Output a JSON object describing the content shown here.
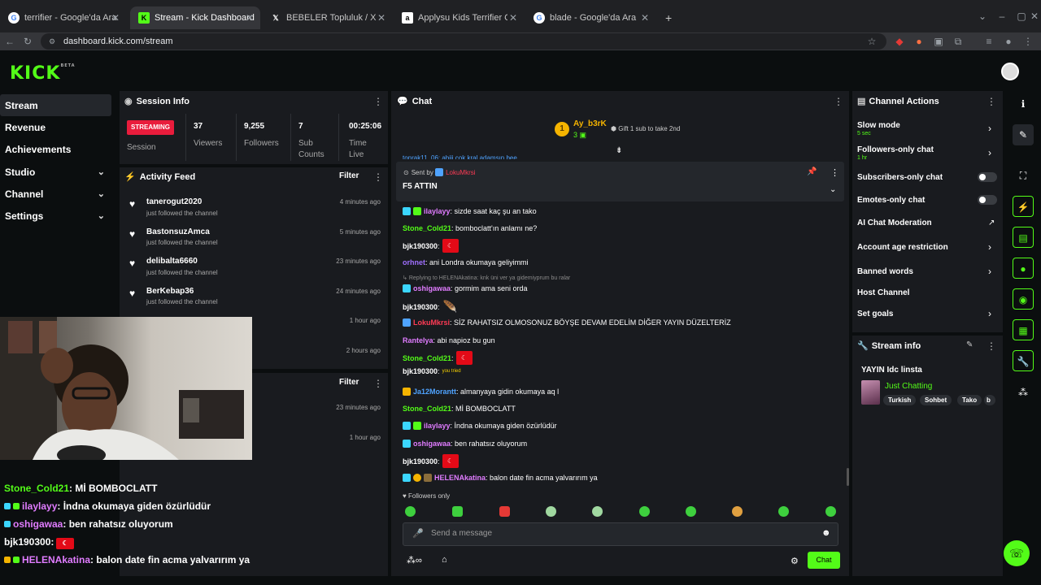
{
  "browser": {
    "tabs": [
      {
        "title": "terrifier - Google'da Ara",
        "icon": "google-icon"
      },
      {
        "title": "Stream - Kick Dashboard",
        "icon": "kick-icon",
        "active": true
      },
      {
        "title": "BEBELER Topluluk / X",
        "icon": "x-icon"
      },
      {
        "title": "Applysu Kids Terrifier Costume",
        "icon": "amazon-icon"
      },
      {
        "title": "blade - Google'da Ara",
        "icon": "google-icon"
      }
    ],
    "new_tab": "+",
    "url": "dashboard.kick.com/stream"
  },
  "app": {
    "logo": "KICK",
    "logo_badge": "BETA"
  },
  "sidebar": {
    "items": [
      {
        "label": "Stream",
        "active": true
      },
      {
        "label": "Revenue"
      },
      {
        "label": "Achievements"
      },
      {
        "label": "Studio",
        "expandable": true
      },
      {
        "label": "Channel",
        "expandable": true
      },
      {
        "label": "Settings",
        "expandable": true
      }
    ]
  },
  "session": {
    "title": "Session Info",
    "status": "STREAMING",
    "status_label": "Session",
    "stats": [
      {
        "value": "37",
        "label": "Viewers"
      },
      {
        "value": "9,255",
        "label": "Followers"
      },
      {
        "value": "7",
        "label": "Sub Counts"
      },
      {
        "value": "00:25:06",
        "label": "Time Live"
      }
    ]
  },
  "activity": {
    "title": "Activity Feed",
    "filter": "Filter",
    "items": [
      {
        "name": "tanerogut2020",
        "action": "just followed the channel",
        "time": "4 minutes ago"
      },
      {
        "name": "BastonsuzAmca",
        "action": "just followed the channel",
        "time": "5 minutes ago"
      },
      {
        "name": "delibalta6660",
        "action": "just followed the channel",
        "time": "23 minutes ago"
      },
      {
        "name": "BerKebap36",
        "action": "just followed the channel",
        "time": "24 minutes ago"
      }
    ],
    "more_times": [
      "1 hour ago",
      "2 hours ago"
    ],
    "filter2": "Filter",
    "more_times2": [
      "23 minutes ago",
      "1 hour ago"
    ]
  },
  "overlay_chat": [
    {
      "user": "Stone_Cold21",
      "msg": ": Mİ BOMBOCLATT",
      "color": "#53fc18"
    },
    {
      "user": "ilaylayy",
      "msg": ": İndna okumaya giden özürlüdür",
      "color": "#e07cff"
    },
    {
      "user": "oshigawaa",
      "msg": ": ben rahatsız oluyorum",
      "color": "#e07cff"
    },
    {
      "user": "bjk190300",
      "msg": ":",
      "color": "#ffffff"
    },
    {
      "user": "HELENAkatina",
      "msg": ": balon date fin acma yalvarırım ya",
      "color": "#e07cff"
    }
  ],
  "chat": {
    "title": "Chat",
    "leader": {
      "rank": "1",
      "name": "Ay_b3rK",
      "count": "3"
    },
    "gift": "Gift 1 sub to take 2nd",
    "partial_line": "tonrak11_06: abiii cok kral adamsın bee",
    "pinned": {
      "sent_by": "Sent by",
      "user": "LokuMkrsi",
      "message": "F5 ATTIN"
    },
    "reply_note": "Replying to HELENAkatina: knk üni ver ya gidemiyprum bu ralar",
    "messages": [
      {
        "user": "ilaylayy",
        "msg": ": sizde saat kaç şu an tako",
        "color": "#e07cff"
      },
      {
        "user": "Stone_Cold21",
        "msg": ": bomboclatt'ın anlamı ne?",
        "color": "#53fc18"
      },
      {
        "user": "bjk190300",
        "msg": ":",
        "color": "#ffffff"
      },
      {
        "user": "orhnet",
        "msg": ": ani Londra okumaya geliyimmi",
        "color": "#a070ff"
      },
      {
        "user": "oshigawaa",
        "msg": ": gormim ama seni orda",
        "color": "#e07cff"
      },
      {
        "user": "bjk190300",
        "msg": ":",
        "color": "#ffffff"
      },
      {
        "user": "LokuMkrsi",
        "msg": ": SİZ RAHATSIZ OLMOSONUZ BÖYŞE DEVAM EDELİM DİĞER YAYIN DÜZELTERİZ",
        "color": "#ff3b55"
      },
      {
        "user": "Rantelya",
        "msg": ": abi napioz bu gun",
        "color": "#e07cff"
      },
      {
        "user": "Stone_Cold21",
        "msg": ":",
        "color": "#53fc18"
      },
      {
        "user": "bjk190300",
        "msg": ":",
        "color": "#ffffff"
      },
      {
        "user": "Ja12Morantt",
        "msg": ": almanyaya gidin okumaya aq l",
        "color": "#4fa3ff"
      },
      {
        "user": "Stone_Cold21",
        "msg": ": Mİ BOMBOCLATT",
        "color": "#53fc18"
      },
      {
        "user": "ilaylayy",
        "msg": ": İndna okumaya giden özürlüdür",
        "color": "#e07cff"
      },
      {
        "user": "oshigawaa",
        "msg": ": ben rahatsız oluyorum",
        "color": "#e07cff"
      },
      {
        "user": "bjk190300",
        "msg": ":",
        "color": "#ffffff"
      },
      {
        "user": "HELENAkatina",
        "msg": ": balon date fin acma yalvarırım ya",
        "color": "#e07cff"
      }
    ],
    "emote_text": "you tried",
    "followers_only": "Followers only",
    "input_placeholder": "Send a message",
    "send": "Chat"
  },
  "channel_actions": {
    "title": "Channel Actions",
    "rows": [
      {
        "label": "Slow mode",
        "sub": "5 sec",
        "type": "chevron"
      },
      {
        "label": "Followers-only chat",
        "sub": "1 hr",
        "type": "chevron"
      },
      {
        "label": "Subscribers-only chat",
        "type": "toggle"
      },
      {
        "label": "Emotes-only chat",
        "type": "toggle"
      },
      {
        "label": "AI Chat Moderation",
        "type": "external"
      },
      {
        "label": "Account age restriction",
        "type": "chevron"
      },
      {
        "label": "Banned words",
        "type": "chevron"
      },
      {
        "label": "Host Channel",
        "type": "none"
      },
      {
        "label": "Set goals",
        "type": "chevron"
      }
    ]
  },
  "stream_info": {
    "title": "Stream info",
    "stream_title": "YAYIN Idc linsta",
    "category": "Just Chatting",
    "tags": [
      "Turkish",
      "Sohbet",
      "Tako",
      "b"
    ]
  },
  "colors": {
    "accent": "#53fc18",
    "live": "#e91c3c",
    "panel": "#191b1f"
  }
}
